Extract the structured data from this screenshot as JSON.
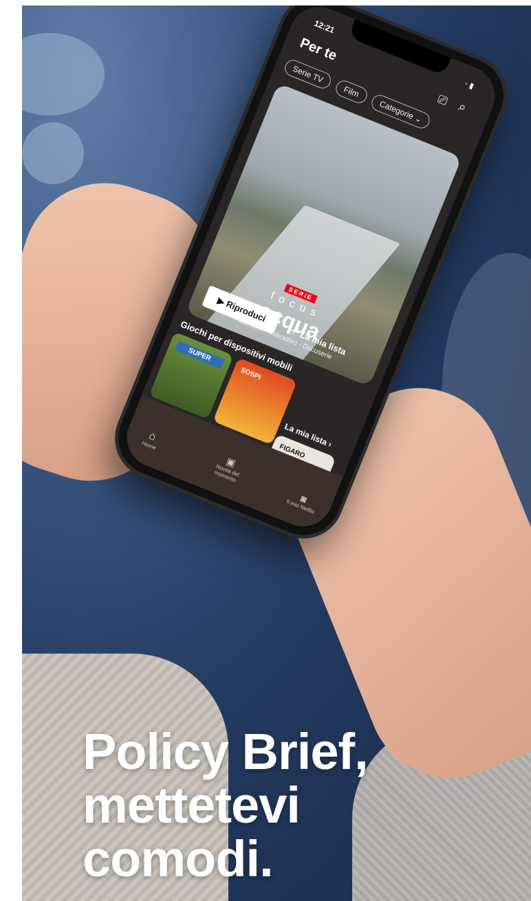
{
  "headline": {
    "line1": "Policy Brief,",
    "line2": "mettetevi",
    "line3": "comodi."
  },
  "phone": {
    "status_time": "12:21",
    "page_title": "Per te",
    "filters": [
      "Serie TV",
      "Film",
      "Categorie"
    ],
    "hero": {
      "badge": "SERIE",
      "brand_top": "focus",
      "brand_main": "acqua",
      "genres": "Futuristico · Interattivo · Docuserie",
      "play_label": "Riproduci",
      "list_label": "La mia lista"
    },
    "row_games": {
      "title": "Giochi per dispositivi mobili"
    },
    "row_mylist": {
      "title": "La mia lista"
    },
    "tiles": [
      "SUPER",
      "SOSPI",
      "FIGARO"
    ],
    "tabbar": {
      "home": "Home",
      "new": "Novità del momento",
      "mine": "Il mio Netflix"
    }
  },
  "colors": {
    "accent_text": "#ffffff",
    "tabbar": "#3b302c",
    "screen_bg": "#2a2626"
  }
}
